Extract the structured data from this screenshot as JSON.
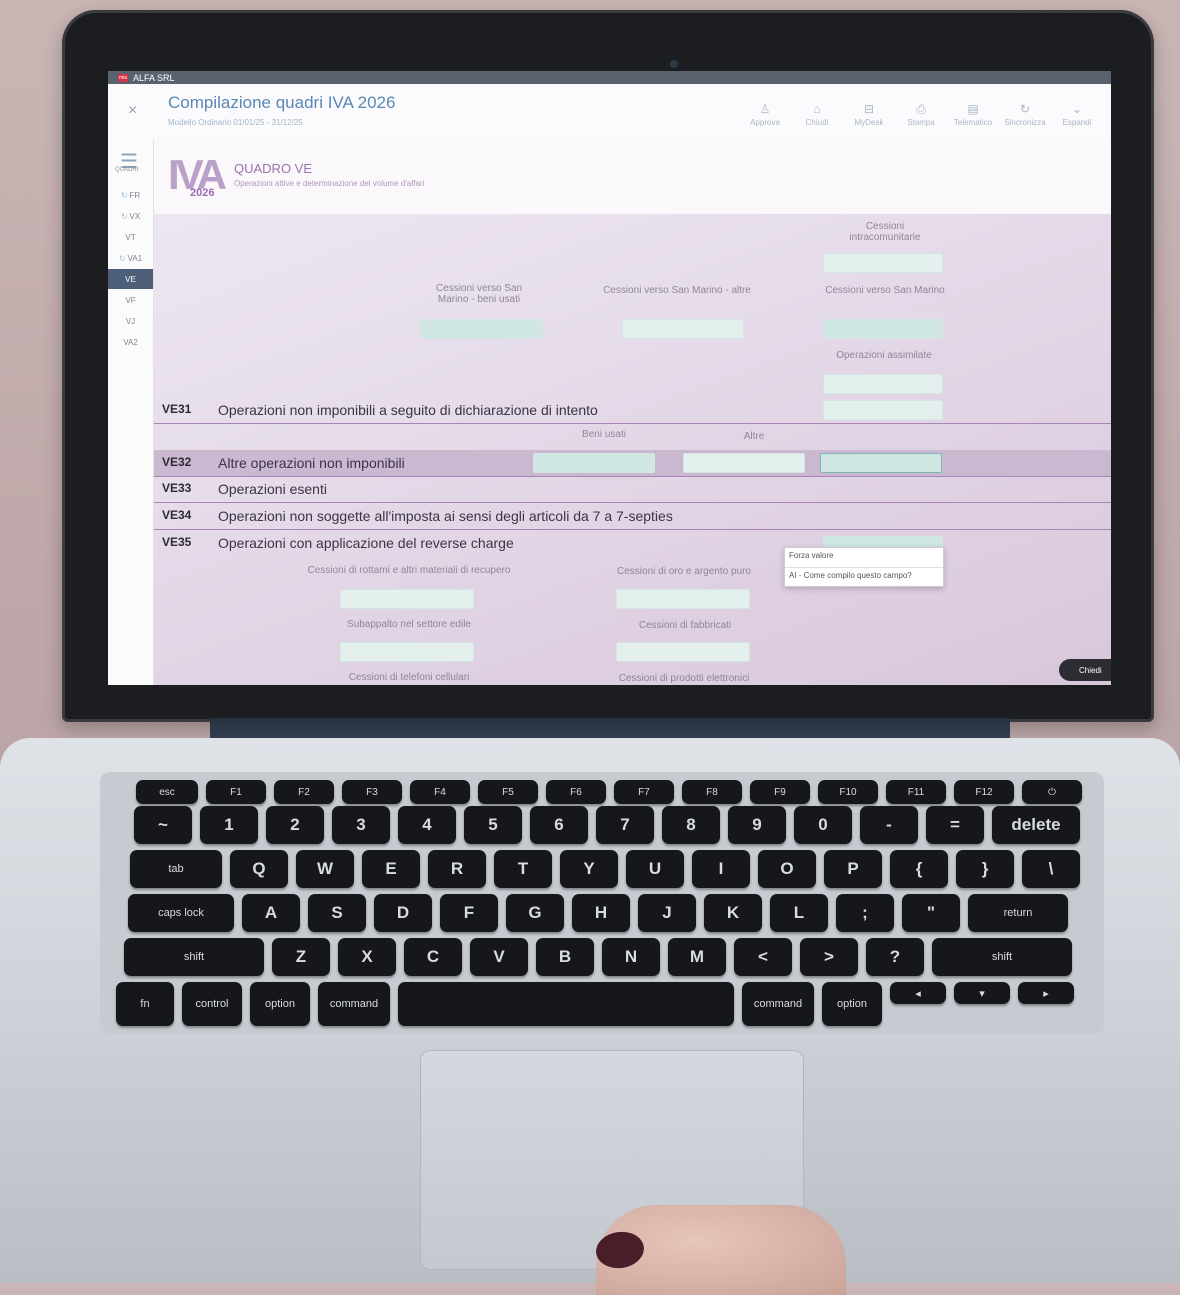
{
  "window": {
    "company": "ALFA SRL",
    "logo_text": "mia"
  },
  "header": {
    "title": "Compilazione quadri IVA 2026",
    "subtitle": "Modello Ordinario 01/01/25 - 31/12/25",
    "close_glyph": "×",
    "toolbar": [
      {
        "label": "Approva",
        "icon": "approve-icon",
        "glyph": "♙"
      },
      {
        "label": "Chiudi",
        "icon": "lock-icon",
        "glyph": "⌂"
      },
      {
        "label": "MyDesk",
        "icon": "desk-icon",
        "glyph": "⊟"
      },
      {
        "label": "Stampa",
        "icon": "print-icon",
        "glyph": "⎙"
      },
      {
        "label": "Telematico",
        "icon": "file-icon",
        "glyph": "▤"
      },
      {
        "label": "Sincronizza",
        "icon": "sync-icon",
        "glyph": "↻"
      },
      {
        "label": "Espandi",
        "icon": "chevron-down-icon",
        "glyph": "⌄"
      }
    ]
  },
  "sidebar": {
    "menu_glyph": "☰",
    "label": "QUADRI",
    "items": [
      {
        "label": "FR",
        "sync": true
      },
      {
        "label": "VX",
        "sync": true
      },
      {
        "label": "VT",
        "sync": false
      },
      {
        "label": "VA1",
        "sync": true
      },
      {
        "label": "VE",
        "sync": false,
        "active": true
      },
      {
        "label": "VF",
        "sync": false
      },
      {
        "label": "VJ",
        "sync": false
      },
      {
        "label": "VA2",
        "sync": false
      }
    ]
  },
  "quadro": {
    "logo_big": "IVA",
    "logo_year": "2026",
    "title": "QUADRO VE",
    "subtitle": "Operazioni attive e determinazione del volume d'affari"
  },
  "labels": {
    "cessioni_intra": "Cessioni intracomunitarie",
    "sm_beni_usati": "Cessioni verso San Marino - beni usati",
    "sm_altre": "Cessioni verso San Marino - altre",
    "sm": "Cessioni verso San Marino",
    "op_assimilate": "Operazioni assimilate",
    "beni_usati": "Beni usati",
    "altre": "Altre",
    "rottami": "Cessioni di rottami e altri materiali di recupero",
    "oro": "Cessioni di oro e argento puro",
    "subappalto": "Subappalto nel settore edile",
    "fabbricati": "Cessioni di fabbricati",
    "telefoni": "Cessioni di telefoni cellulari",
    "elettronici": "Cessioni di prodotti elettronici"
  },
  "rows": [
    {
      "code": "VE31",
      "title": "Operazioni non imponibili a seguito di dichiarazione di intento"
    },
    {
      "code": "VE32",
      "title": "Altre operazioni non imponibili"
    },
    {
      "code": "VE33",
      "title": "Operazioni esenti"
    },
    {
      "code": "VE34",
      "title": "Operazioni non soggette all'imposta ai sensi degli articoli da 7 a 7-septies"
    },
    {
      "code": "VE35",
      "title": "Operazioni con applicazione del reverse charge"
    }
  ],
  "popup": {
    "force": "Forza valore",
    "ai": "AI - Come compilo questo campo?"
  },
  "chat_button": "Chiedi",
  "keyboard": {
    "fn_row": [
      "esc",
      "F1",
      "F2",
      "F3",
      "F4",
      "F5",
      "F6",
      "F7",
      "F8",
      "F9",
      "F10",
      "F11",
      "F12",
      "⏻"
    ],
    "num_row": [
      "~",
      "1",
      "2",
      "3",
      "4",
      "5",
      "6",
      "7",
      "8",
      "9",
      "0",
      "-",
      "=",
      "delete"
    ],
    "q_row": [
      "tab",
      "Q",
      "W",
      "E",
      "R",
      "T",
      "Y",
      "U",
      "I",
      "O",
      "P",
      "{",
      "}",
      "\\"
    ],
    "a_row": [
      "caps lock",
      "A",
      "S",
      "D",
      "F",
      "G",
      "H",
      "J",
      "K",
      "L",
      ";",
      "\"",
      "return"
    ],
    "z_row": [
      "shift",
      "Z",
      "X",
      "C",
      "V",
      "B",
      "N",
      "M",
      "<",
      ">",
      "?",
      "shift"
    ],
    "bottom_row": [
      "fn",
      "control",
      "option",
      "command",
      "",
      "command",
      "option",
      "◂",
      "▾",
      "▸"
    ]
  }
}
